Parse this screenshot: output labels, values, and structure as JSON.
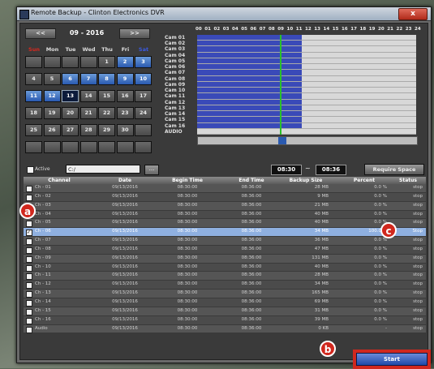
{
  "window": {
    "title": "Remote Backup - Clinton Electronics DVR",
    "close_label": "x"
  },
  "calendar": {
    "prev_label": "<<",
    "next_label": ">>",
    "month_label": "09 - 2016",
    "weekdays": [
      "Sun",
      "Mon",
      "Tue",
      "Wed",
      "Thu",
      "Fri",
      "Sat"
    ],
    "weeks": [
      [
        "",
        "",
        "",
        "",
        "1",
        "2",
        "3"
      ],
      [
        "4",
        "5",
        "6",
        "7",
        "8",
        "9",
        "10"
      ],
      [
        "11",
        "12",
        "13",
        "14",
        "15",
        "16",
        "17"
      ],
      [
        "18",
        "19",
        "20",
        "21",
        "22",
        "23",
        "24"
      ],
      [
        "25",
        "26",
        "27",
        "28",
        "29",
        "30",
        ""
      ],
      [
        "",
        "",
        "",
        "",
        "",
        "",
        ""
      ]
    ],
    "highlighted": [
      "2",
      "3",
      "6",
      "7",
      "8",
      "9",
      "10",
      "11",
      "12"
    ],
    "selected": "13",
    "colors": {
      "sun": "#d8281e",
      "sat": "#3a5ae0"
    }
  },
  "timeline": {
    "hours": [
      "00",
      "01",
      "02",
      "03",
      "04",
      "05",
      "06",
      "07",
      "08",
      "09",
      "10",
      "11",
      "12",
      "13",
      "14",
      "15",
      "16",
      "17",
      "18",
      "19",
      "20",
      "21",
      "22",
      "23",
      "24"
    ],
    "cameras": [
      "Cam 01",
      "Cam 02",
      "Cam 03",
      "Cam 04",
      "Cam 05",
      "Cam 06",
      "Cam 07",
      "Cam 08",
      "Cam 09",
      "Cam 10",
      "Cam 11",
      "Cam 12",
      "Cam 13",
      "Cam 14",
      "Cam 15",
      "Cam 16",
      "AUDIO"
    ],
    "recorded_end_hour": 11.5,
    "cursor_hour": 9.1,
    "scroll_position": 0.38
  },
  "controls": {
    "active_label": "Active",
    "path_value": "C:/",
    "browse_label": "...",
    "start_time": "08:30",
    "separator": "~",
    "end_time": "08:36",
    "require_space_label": "Require Space"
  },
  "table": {
    "headers": [
      "Channel",
      "Date",
      "Begin Time",
      "End Time",
      "Backup Size",
      "Percent",
      "Status"
    ],
    "rows": [
      {
        "channel": "Ch - 01",
        "date": "09/13/2016",
        "begin": "08:30:00",
        "end": "08:36:00",
        "size": "28 MB",
        "percent": "0.0 %",
        "status": "stop",
        "checked": false,
        "highlight": false
      },
      {
        "channel": "Ch - 02",
        "date": "09/13/2016",
        "begin": "08:30:00",
        "end": "08:36:00",
        "size": "9 MB",
        "percent": "0.0 %",
        "status": "stop",
        "checked": false,
        "highlight": false
      },
      {
        "channel": "Ch - 03",
        "date": "09/13/2016",
        "begin": "08:30:00",
        "end": "08:36:00",
        "size": "21 MB",
        "percent": "0.0 %",
        "status": "stop",
        "checked": false,
        "highlight": false
      },
      {
        "channel": "Ch - 04",
        "date": "09/13/2016",
        "begin": "08:30:00",
        "end": "08:36:00",
        "size": "40 MB",
        "percent": "0.0 %",
        "status": "stop",
        "checked": false,
        "highlight": false
      },
      {
        "channel": "Ch - 05",
        "date": "09/13/2016",
        "begin": "08:30:00",
        "end": "08:36:00",
        "size": "40 MB",
        "percent": "0.0 %",
        "status": "stop",
        "checked": false,
        "highlight": false
      },
      {
        "channel": "Ch - 06",
        "date": "09/13/2016",
        "begin": "08:30:00",
        "end": "08:36:00",
        "size": "34 MB",
        "percent": "100.0 %",
        "status": "Stop",
        "checked": true,
        "highlight": true
      },
      {
        "channel": "Ch - 07",
        "date": "09/13/2016",
        "begin": "08:30:00",
        "end": "08:36:00",
        "size": "36 MB",
        "percent": "0.0 %",
        "status": "stop",
        "checked": false,
        "highlight": false
      },
      {
        "channel": "Ch - 08",
        "date": "09/13/2016",
        "begin": "08:30:00",
        "end": "08:36:00",
        "size": "47 MB",
        "percent": "0.0 %",
        "status": "stop",
        "checked": false,
        "highlight": false
      },
      {
        "channel": "Ch - 09",
        "date": "09/13/2016",
        "begin": "08:30:00",
        "end": "08:36:00",
        "size": "131 MB",
        "percent": "0.0 %",
        "status": "stop",
        "checked": false,
        "highlight": false
      },
      {
        "channel": "Ch - 10",
        "date": "09/13/2016",
        "begin": "08:30:00",
        "end": "08:36:00",
        "size": "40 MB",
        "percent": "0.0 %",
        "status": "stop",
        "checked": false,
        "highlight": false
      },
      {
        "channel": "Ch - 11",
        "date": "09/13/2016",
        "begin": "08:30:00",
        "end": "08:36:00",
        "size": "28 MB",
        "percent": "0.0 %",
        "status": "stop",
        "checked": false,
        "highlight": false
      },
      {
        "channel": "Ch - 12",
        "date": "09/13/2016",
        "begin": "08:30:00",
        "end": "08:36:00",
        "size": "34 MB",
        "percent": "0.0 %",
        "status": "stop",
        "checked": false,
        "highlight": false
      },
      {
        "channel": "Ch - 13",
        "date": "09/13/2016",
        "begin": "08:30:00",
        "end": "08:36:00",
        "size": "165 MB",
        "percent": "0.0 %",
        "status": "stop",
        "checked": false,
        "highlight": false
      },
      {
        "channel": "Ch - 14",
        "date": "09/13/2016",
        "begin": "08:30:00",
        "end": "08:36:00",
        "size": "69 MB",
        "percent": "0.0 %",
        "status": "stop",
        "checked": false,
        "highlight": false
      },
      {
        "channel": "Ch - 15",
        "date": "09/13/2016",
        "begin": "08:30:00",
        "end": "08:36:00",
        "size": "31 MB",
        "percent": "0.0 %",
        "status": "stop",
        "checked": false,
        "highlight": false
      },
      {
        "channel": "Ch - 16",
        "date": "09/13/2016",
        "begin": "08:30:00",
        "end": "08:36:00",
        "size": "39 MB",
        "percent": "0.0 %",
        "status": "stop",
        "checked": false,
        "highlight": false
      },
      {
        "channel": "Audio",
        "date": "09/13/2016",
        "begin": "08:30:00",
        "end": "08:36:00",
        "size": "0 KB",
        "percent": "-",
        "status": "stop",
        "checked": false,
        "highlight": false
      }
    ]
  },
  "start_button": {
    "label": "Start"
  },
  "callouts": {
    "a": "a",
    "b": "b",
    "c": "c",
    "color": "#d0281e"
  }
}
